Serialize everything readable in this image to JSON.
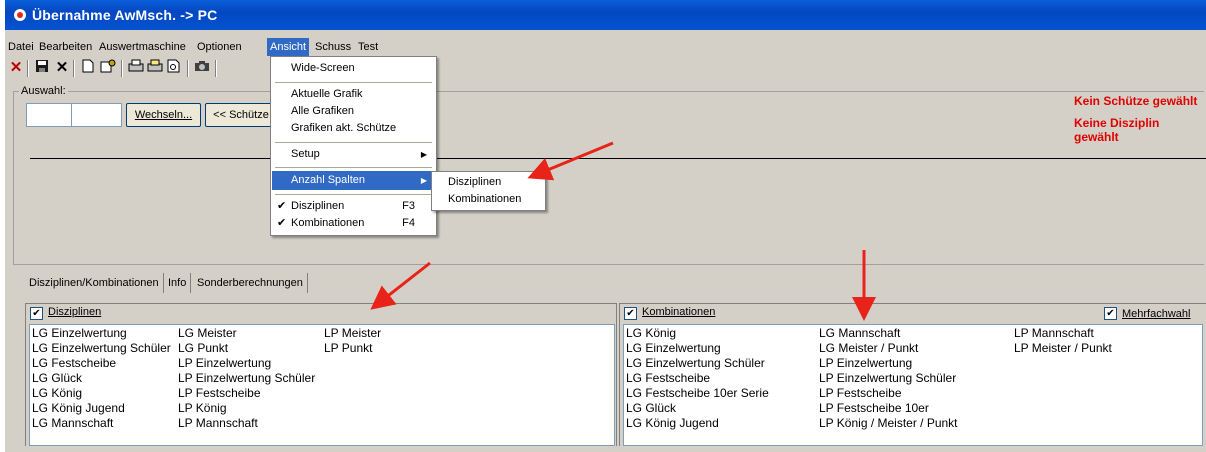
{
  "window": {
    "title": "Übernahme AwMsch. -> PC"
  },
  "menubar": [
    "Datei",
    "Bearbeiten",
    "Auswertmaschine",
    "Optionen",
    "Ansicht",
    "Schuss",
    "Test"
  ],
  "toolbar_icons": [
    "close-red-x",
    "save",
    "delete",
    "new-file",
    "fields",
    "print",
    "print-preview",
    "camera"
  ],
  "auswahl": {
    "label": "Auswahl:",
    "wechseln_label": "Wechseln...",
    "prev_label": "<< Schütze"
  },
  "status": {
    "no_shooter": "Kein Schütze gewählt",
    "no_discipline": "Keine Disziplin gewählt"
  },
  "tabs": [
    "Disziplinen/Kombinationen",
    "Info",
    "Sonderberechnungen"
  ],
  "disziplinen": {
    "label": "Disziplinen",
    "checked": true,
    "columns": [
      [
        "LG Einzelwertung",
        "LG Einzelwertung Schüler",
        "LG Festscheibe",
        "LG Glück",
        "LG König",
        "LG König Jugend",
        "LG Mannschaft"
      ],
      [
        "LG Meister",
        "LG Punkt",
        "LP Einzelwertung",
        "LP Einzelwertung Schüler",
        "LP Festscheibe",
        "LP König",
        "LP Mannschaft"
      ],
      [
        "LP Meister",
        "LP Punkt"
      ]
    ]
  },
  "kombinationen": {
    "label": "Kombinationen",
    "checked": true,
    "mehrfachwahl_label": "Mehrfachwahl",
    "mehrfachwahl_checked": true,
    "columns": [
      [
        "LG  König",
        "LG Einzelwertung",
        "LG Einzelwertung Schüler",
        "LG Festscheibe",
        "LG Festscheibe 10er Serie",
        "LG Glück",
        "LG König Jugend"
      ],
      [
        "LG Mannschaft",
        "LG Meister / Punkt",
        "LP Einzelwertung",
        "LP Einzelwertung Schüler",
        "LP Festscheibe",
        "LP Festscheibe 10er",
        "LP König / Meister / Punkt"
      ],
      [
        "LP Mannschaft",
        "LP Meister / Punkt"
      ]
    ]
  },
  "ansicht_menu": {
    "wide_screen": "Wide-Screen",
    "aktuelle_grafik": "Aktuelle Grafik",
    "alle_grafiken": "Alle Grafiken",
    "grafiken_akt": "Grafiken akt. Schütze",
    "setup": "Setup",
    "anzahl_spalten": "Anzahl Spalten",
    "disziplinen": "Disziplinen",
    "disziplinen_shortcut": "F3",
    "kombinationen": "Kombinationen",
    "kombinationen_shortcut": "F4"
  },
  "submenu": {
    "disziplinen": "Disziplinen",
    "kombinationen": "Kombinationen"
  },
  "colors": {
    "titlebar": "#0553d0",
    "highlight": "#316ac5",
    "status_red": "#e00000",
    "annotation_arrow": "#e8231a"
  }
}
